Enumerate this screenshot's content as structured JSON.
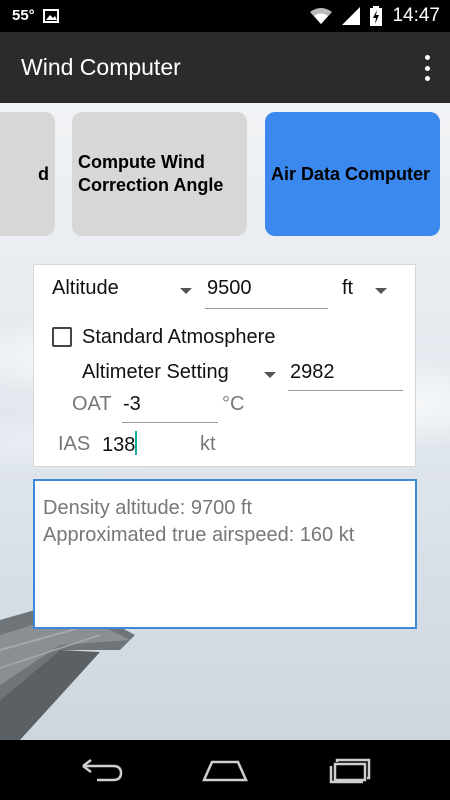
{
  "status_bar": {
    "temperature": "55°",
    "time": "14:47",
    "icons": [
      "image-icon",
      "wifi-icon",
      "signal-icon",
      "battery-charging-icon"
    ]
  },
  "action_bar": {
    "title": "Wind Computer",
    "menu_icon": "overflow-menu-icon"
  },
  "tabs": [
    {
      "label": "d",
      "selected": false
    },
    {
      "label": "Compute Wind Correction Angle",
      "selected": false
    },
    {
      "label": "Air Data Computer",
      "selected": true
    }
  ],
  "form": {
    "altitude": {
      "label": "Altitude",
      "value": "9500",
      "unit": "ft"
    },
    "standard_atmosphere": {
      "label": "Standard Atmosphere",
      "checked": false
    },
    "altimeter": {
      "label": "Altimeter Setting",
      "value": "2982"
    },
    "oat": {
      "label": "OAT",
      "value": "-3",
      "unit": "°C"
    },
    "ias": {
      "label": "IAS",
      "value": "138",
      "unit": "kt"
    }
  },
  "result": {
    "line1": "Density altitude: 9700 ft",
    "line2": "Approximated true airspeed: 160 kt"
  },
  "nav_bar": {
    "icons": [
      "back-icon",
      "home-icon",
      "recent-apps-icon"
    ]
  },
  "colors": {
    "accent": "#3b88ee",
    "result_border": "#3d88d9",
    "cursor": "#1aa99c",
    "action_bar": "#2b2b2b"
  }
}
